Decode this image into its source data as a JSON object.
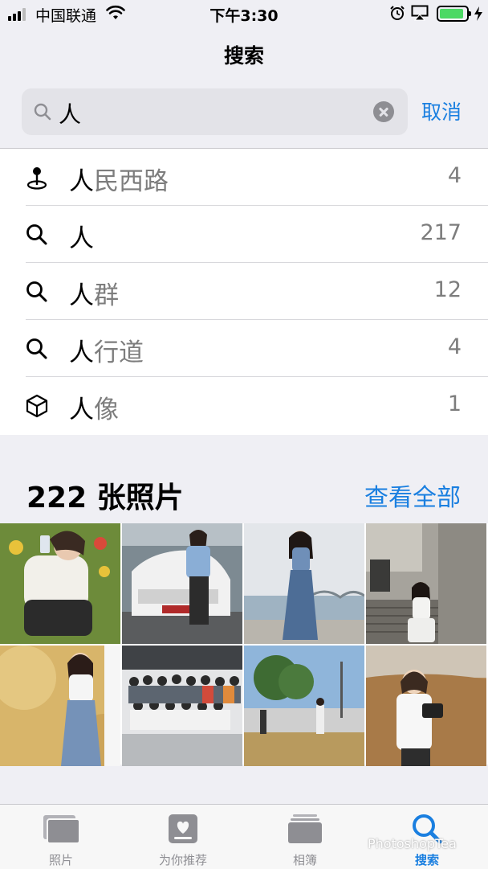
{
  "status_bar": {
    "carrier": "中国联通",
    "time": "下午3:30",
    "battery_level": 0.9
  },
  "nav": {
    "title": "搜索"
  },
  "search": {
    "query": "人",
    "cancel_label": "取消"
  },
  "results": [
    {
      "icon": "location-pin-icon",
      "typed": "人",
      "rest": "民西路",
      "count": "4"
    },
    {
      "icon": "search-icon",
      "typed": "人",
      "rest": "",
      "count": "217"
    },
    {
      "icon": "search-icon",
      "typed": "人",
      "rest": "群",
      "count": "12"
    },
    {
      "icon": "search-icon",
      "typed": "人",
      "rest": "行道",
      "count": "4"
    },
    {
      "icon": "cube-icon",
      "typed": "人",
      "rest": "像",
      "count": "1"
    }
  ],
  "photos_section": {
    "title": "222 张照片",
    "see_all_label": "查看全部"
  },
  "tabbar": {
    "tabs": [
      {
        "label": "照片",
        "icon": "photos-icon"
      },
      {
        "label": "为你推荐",
        "icon": "for-you-icon"
      },
      {
        "label": "相簿",
        "icon": "albums-icon"
      },
      {
        "label": "搜索",
        "icon": "search-icon",
        "active": true
      }
    ]
  },
  "watermark": "PhotoshopTea",
  "colors": {
    "accent": "#1a7fe0",
    "background": "#efeff4",
    "battery": "#4cd964"
  }
}
